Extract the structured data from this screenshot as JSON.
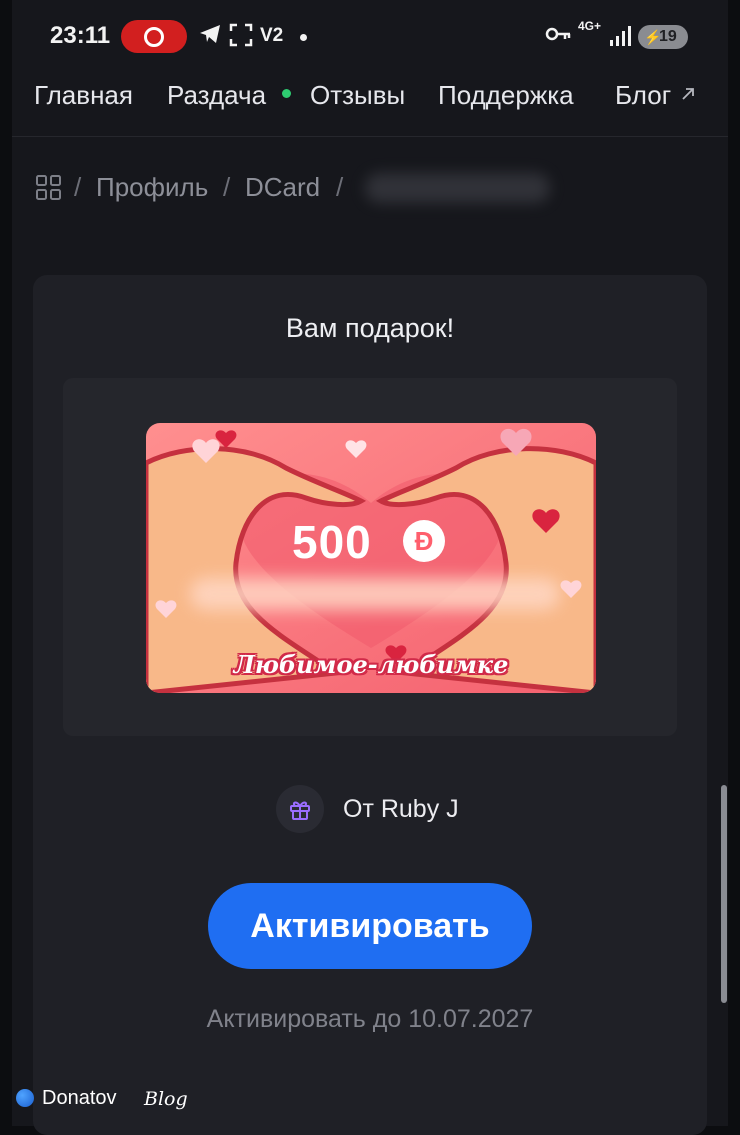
{
  "status_bar": {
    "time": "23:11",
    "vpn_label": "V2",
    "network_label": "4G+",
    "battery_level": "19",
    "record_color": "#d21f1f"
  },
  "nav": {
    "items": [
      {
        "label": "Главная"
      },
      {
        "label": "Раздача",
        "live_dot_color": "#2ecc71"
      },
      {
        "label": "Отзывы"
      },
      {
        "label": "Поддержка"
      },
      {
        "label": "Блог",
        "icon": "external-link-icon"
      }
    ]
  },
  "breadcrumb": {
    "home_icon": "grid-icon",
    "items": [
      "Профиль",
      "DCard"
    ],
    "separator": "/"
  },
  "gift": {
    "title": "Вам подарок!",
    "card": {
      "amount": "500",
      "currency_symbol": "Đ",
      "caption": "Любимое-любимке",
      "background_color": "#f8727a"
    },
    "from_icon": "gift-icon",
    "from_label": "От Ruby J",
    "activate_label": "Активировать",
    "activate_color": "#1f6ef2",
    "expiry_text": "Активировать до 10.07.2027"
  },
  "watermark": {
    "brand": "Donatov",
    "suffix": "Blog"
  }
}
